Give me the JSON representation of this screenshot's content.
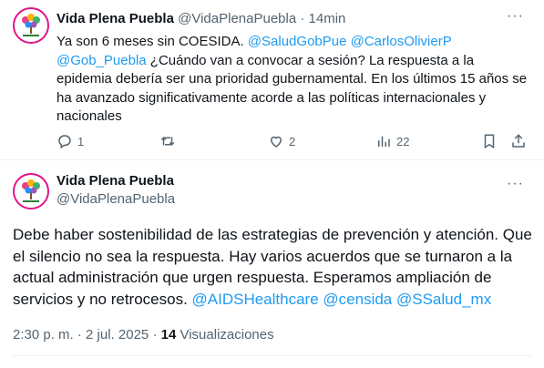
{
  "tweet1": {
    "display_name": "Vida Plena Puebla",
    "handle": "@VidaPlenaPuebla",
    "separator": "·",
    "time": "14min",
    "more_label": "···",
    "body": {
      "t1": "Ya son 6 meses sin COESIDA. ",
      "m1": "@SaludGobPue",
      "t2": " ",
      "m2": "@CarlosOlivierP",
      "t3": " ",
      "m3": "@Gob_Puebla",
      "t4": " ¿Cuándo van a convocar a sesión? La respuesta a la epidemia debería ser una prioridad gubernamental. En los últimos 15 años se ha avanzado significativamente acorde a las políticas internacionales y nacionales"
    },
    "actions": {
      "replies": "1",
      "likes": "2",
      "views": "22"
    }
  },
  "tweet2": {
    "display_name": "Vida Plena Puebla",
    "handle": "@VidaPlenaPuebla",
    "more_label": "···",
    "body": {
      "t1": "Debe haber sostenibilidad de las estrategias de prevención y atención. Que el silencio no sea la respuesta. Hay varios acuerdos que se turnaron a la actual administración que urgen respuesta. Esperamos ampliación de  servicios y no retrocesos. ",
      "m1": "@AIDSHealthcare",
      "t2": " ",
      "m2": "@censida",
      "t3": " ",
      "m3": "@SSalud_mx"
    },
    "meta": {
      "time": "2:30 p. m.",
      "separator": " · ",
      "date": "2 jul. 2025",
      "separator2": " · ",
      "views_count": "14",
      "views_label": " Visualizaciones"
    }
  },
  "colors": {
    "accent": "#1d9bf0",
    "muted": "#536471",
    "avatar_ring": "#e0148a"
  },
  "icons": [
    "reply-icon",
    "retweet-icon",
    "like-icon",
    "views-icon",
    "bookmark-icon",
    "share-icon",
    "more-icon"
  ]
}
